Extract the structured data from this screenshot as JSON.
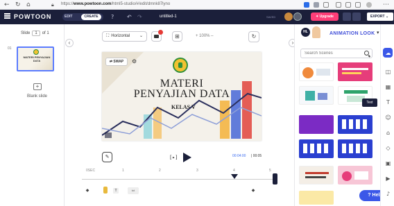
{
  "browser": {
    "url_prefix": "https://",
    "url_domain": "www.powtoon.com",
    "url_path": "/html5-studio/#/edit/dmnk87lyno",
    "icons": [
      "back-icon",
      "refresh-icon",
      "home-icon",
      "lock-icon"
    ]
  },
  "header": {
    "logo": "POWTOON",
    "mode_edit": "EDIT",
    "mode_create": "CREATE",
    "doc_title": "untitled-1",
    "saved": "SAVED",
    "upgrade": "✦ Upgrade",
    "export": "EXPORT ⌄"
  },
  "slides": {
    "label": "Slide",
    "current": "1",
    "of": "of 1",
    "index": "01",
    "thumb_title": "MATERI PENYAJIAN DATA",
    "add_blank": "Blank slide"
  },
  "toolbar": {
    "orientation": "Horizontal",
    "zoom": "+ 100% –"
  },
  "canvas": {
    "swap": "SWAP",
    "title_line1": "MATERI",
    "title_line2": "PENYAJIAN DATA",
    "subtitle": "KELAS V"
  },
  "player": {
    "frame_btn": "[▸]",
    "time_current": "00:04:00",
    "time_total": "| 00:05",
    "ticks": [
      "0SEC",
      "1",
      "2",
      "3",
      "4",
      "5"
    ]
  },
  "panel": {
    "badge": "HL",
    "title": "ANIMATION LOOK",
    "search_placeholder": "Search Scenes",
    "tooltip": "Text",
    "help": "? Help"
  },
  "colors": {
    "header_bg": "#1b1f3a",
    "accent": "#3b57e8",
    "upgrade": "#ff3e78",
    "panel_title": "#3f4dd8"
  }
}
